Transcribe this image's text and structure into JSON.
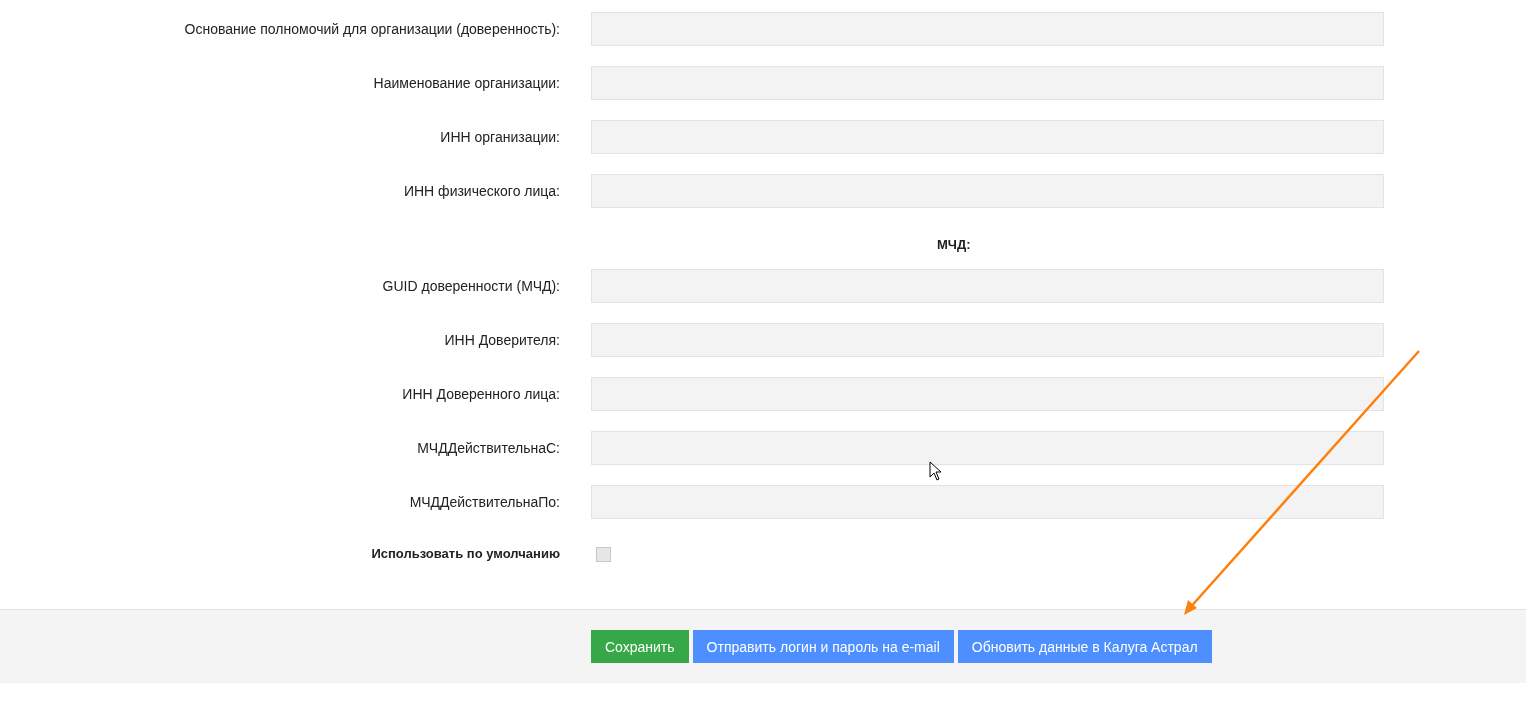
{
  "form": {
    "rows": [
      {
        "kind": "field",
        "label": "Основание полномочий для организации (доверенность):"
      },
      {
        "kind": "field",
        "label": "Наименование организации:"
      },
      {
        "kind": "field",
        "label": "ИНН организации:"
      },
      {
        "kind": "field",
        "label": "ИНН физического лица:"
      },
      {
        "kind": "heading",
        "text": "МЧД:"
      },
      {
        "kind": "field",
        "label": "GUID доверенности (МЧД):"
      },
      {
        "kind": "field",
        "label": "ИНН Доверителя:"
      },
      {
        "kind": "field",
        "label": "ИНН Доверенного лица:"
      },
      {
        "kind": "field",
        "label": "МЧДДействительнаС:"
      },
      {
        "kind": "field",
        "label": "МЧДДействительнаПо:"
      },
      {
        "kind": "checkbox",
        "label": "Использовать по умолчанию",
        "checked": false
      }
    ]
  },
  "actions": [
    {
      "label": "Сохранить",
      "kind": "primary"
    },
    {
      "label": "Отправить логин и пароль на e-mail",
      "kind": "secondary"
    },
    {
      "label": "Обновить данные в Калуга Астрал",
      "kind": "secondary"
    }
  ]
}
